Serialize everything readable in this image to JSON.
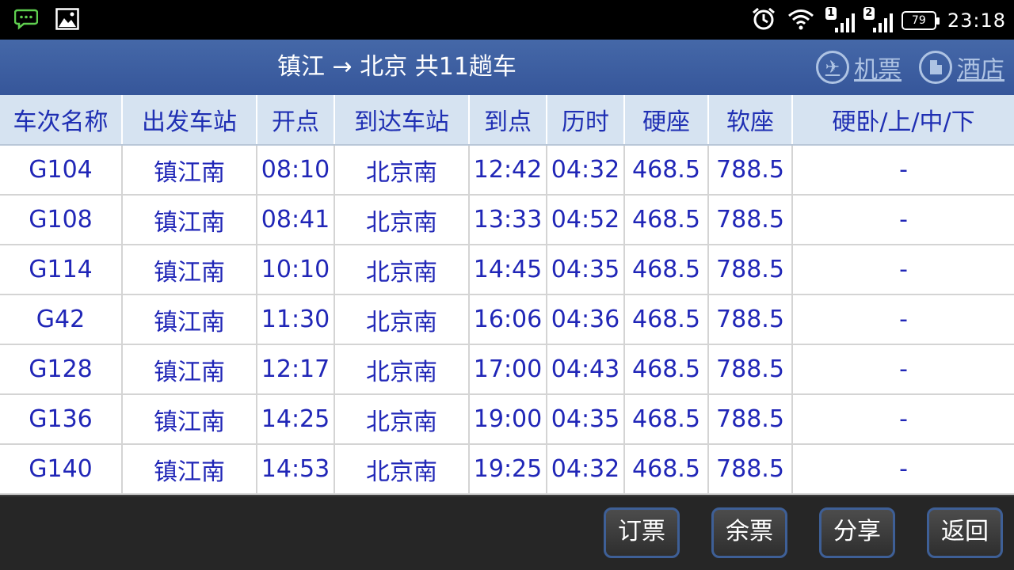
{
  "statusbar": {
    "time": "23:18",
    "battery": "79",
    "sim1": "1",
    "sim2": "2",
    "icons": [
      "message-icon",
      "image-icon",
      "alarm-icon",
      "wifi-icon",
      "signal-icon",
      "battery-icon"
    ]
  },
  "header": {
    "title": "镇江 → 北京 共11趟车",
    "actions": [
      {
        "label": "机票",
        "icon": "airplane-icon"
      },
      {
        "label": "酒店",
        "icon": "hotel-icon"
      }
    ]
  },
  "table": {
    "columns": [
      "车次名称",
      "出发车站",
      "开点",
      "到达车站",
      "到点",
      "历时",
      "硬座",
      "软座",
      "硬卧/上/中/下"
    ],
    "rows": [
      [
        "G104",
        "镇江南",
        "08:10",
        "北京南",
        "12:42",
        "04:32",
        "468.5",
        "788.5",
        "-"
      ],
      [
        "G108",
        "镇江南",
        "08:41",
        "北京南",
        "13:33",
        "04:52",
        "468.5",
        "788.5",
        "-"
      ],
      [
        "G114",
        "镇江南",
        "10:10",
        "北京南",
        "14:45",
        "04:35",
        "468.5",
        "788.5",
        "-"
      ],
      [
        "G42",
        "镇江南",
        "11:30",
        "北京南",
        "16:06",
        "04:36",
        "468.5",
        "788.5",
        "-"
      ],
      [
        "G128",
        "镇江南",
        "12:17",
        "北京南",
        "17:00",
        "04:43",
        "468.5",
        "788.5",
        "-"
      ],
      [
        "G136",
        "镇江南",
        "14:25",
        "北京南",
        "19:00",
        "04:35",
        "468.5",
        "788.5",
        "-"
      ],
      [
        "G140",
        "镇江南",
        "14:53",
        "北京南",
        "19:25",
        "04:32",
        "468.5",
        "788.5",
        "-"
      ]
    ]
  },
  "bottom": {
    "buttons": [
      "订票",
      "余票",
      "分享",
      "返回"
    ]
  },
  "colors": {
    "header_bg": "#3f60a2",
    "table_header_bg": "#d6e3f1",
    "text_blue": "#2026b7",
    "bottom_bg": "#262626"
  }
}
